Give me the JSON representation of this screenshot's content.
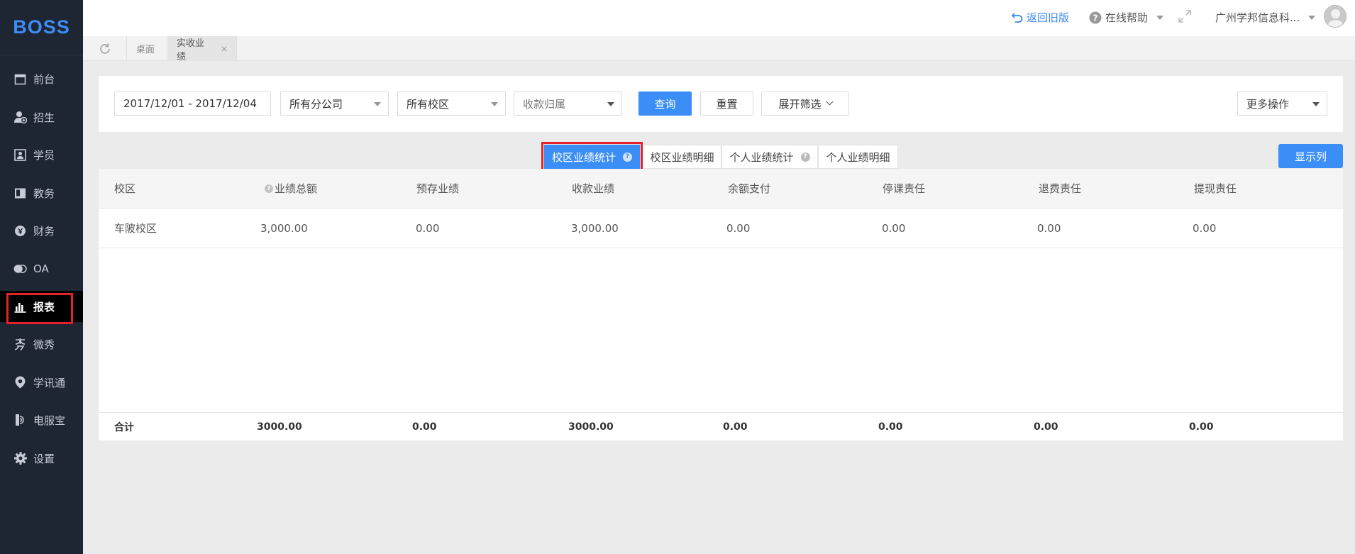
{
  "app": {
    "logo_text": "BOSS"
  },
  "sidebar": {
    "items": [
      {
        "label": "前台",
        "icon": "calendar-icon"
      },
      {
        "label": "招生",
        "icon": "user-add-icon"
      },
      {
        "label": "学员",
        "icon": "student-card-icon"
      },
      {
        "label": "教务",
        "icon": "book-icon"
      },
      {
        "label": "财务",
        "icon": "finance-icon"
      },
      {
        "label": "OA",
        "icon": "chat-bubbles-icon"
      },
      {
        "label": "报表",
        "icon": "bar-chart-icon",
        "active": true
      },
      {
        "label": "微秀",
        "icon": "weixiu-icon"
      },
      {
        "label": "学讯通",
        "icon": "location-pin-icon"
      },
      {
        "label": "电服宝",
        "icon": "phone-service-icon"
      },
      {
        "label": "设置",
        "icon": "gear-icon"
      }
    ]
  },
  "topbar": {
    "back_old": "返回旧版",
    "help": "在线帮助",
    "org": "广州学邦信息科..."
  },
  "page_tabs": {
    "desk": "桌面",
    "current": "实收业绩",
    "close": "×"
  },
  "filters": {
    "date_range": "2017/12/01 - 2017/12/04",
    "branch": "所有分公司",
    "campus": "所有校区",
    "payee_placeholder": "收款归属",
    "query": "查询",
    "reset": "重置",
    "expand": "展开筛选",
    "more_actions": "更多操作"
  },
  "report_tabs": [
    "校区业绩统计",
    "校区业绩明细",
    "个人业绩统计",
    "个人业绩明细"
  ],
  "show_columns": "显示列",
  "table": {
    "headers": [
      "校区",
      "业绩总额",
      "预存业绩",
      "收款业绩",
      "余额支付",
      "停课责任",
      "退费责任",
      "提现责任"
    ],
    "rows": [
      [
        "车陂校区",
        "3,000.00",
        "0.00",
        "3,000.00",
        "0.00",
        "0.00",
        "0.00",
        "0.00"
      ]
    ],
    "footer": [
      "合计",
      "3000.00",
      "0.00",
      "3000.00",
      "0.00",
      "0.00",
      "0.00",
      "0.00"
    ]
  },
  "colors": {
    "primary": "#3a8ef6",
    "sidebar_bg": "#1e2533",
    "highlight": "#e5212a"
  }
}
